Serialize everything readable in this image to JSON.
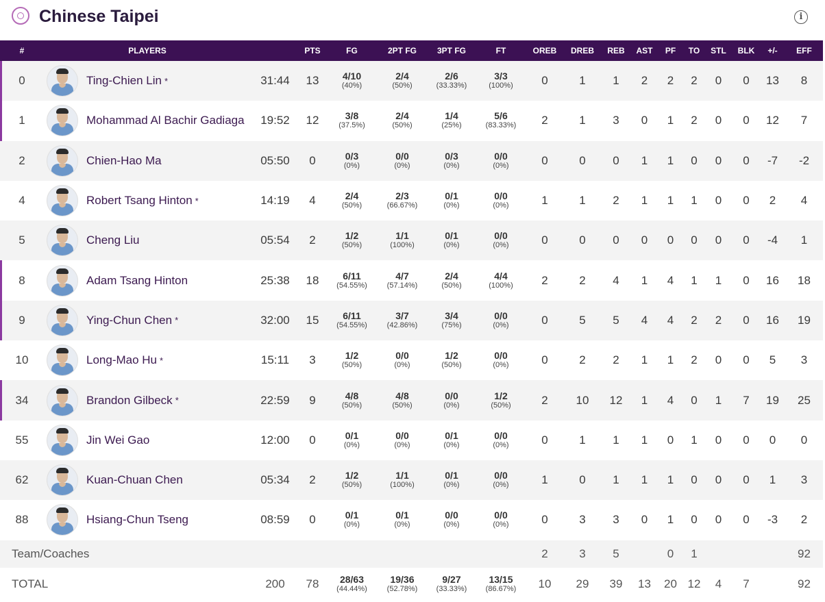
{
  "header": {
    "team_name": "Chinese Taipei",
    "logo_icon": "team-flag-logo-icon",
    "info_icon": "info-icon"
  },
  "columns": [
    "#",
    "PLAYERS",
    "",
    "PTS",
    "FG",
    "2PT FG",
    "3PT FG",
    "FT",
    "OREB",
    "DREB",
    "REB",
    "AST",
    "PF",
    "TO",
    "STL",
    "BLK",
    "+/-",
    "EFF"
  ],
  "players": [
    {
      "num": "0",
      "name": "Ting-Chien Lin",
      "star": "*",
      "min": "31:44",
      "pts": "13",
      "fg": "4/10",
      "fgp": "(40%)",
      "fg2": "2/4",
      "fg2p": "(50%)",
      "fg3": "2/6",
      "fg3p": "(33.33%)",
      "ft": "3/3",
      "ftp": "(100%)",
      "oreb": "0",
      "dreb": "1",
      "reb": "1",
      "ast": "2",
      "pf": "2",
      "to": "2",
      "stl": "0",
      "blk": "0",
      "pm": "13",
      "eff": "8",
      "starter": true
    },
    {
      "num": "1",
      "name": "Mohammad Al Bachir Gadiaga",
      "star": "",
      "min": "19:52",
      "pts": "12",
      "fg": "3/8",
      "fgp": "(37.5%)",
      "fg2": "2/4",
      "fg2p": "(50%)",
      "fg3": "1/4",
      "fg3p": "(25%)",
      "ft": "5/6",
      "ftp": "(83.33%)",
      "oreb": "2",
      "dreb": "1",
      "reb": "3",
      "ast": "0",
      "pf": "1",
      "to": "2",
      "stl": "0",
      "blk": "0",
      "pm": "12",
      "eff": "7",
      "starter": true
    },
    {
      "num": "2",
      "name": "Chien-Hao Ma",
      "star": "",
      "min": "05:50",
      "pts": "0",
      "fg": "0/3",
      "fgp": "(0%)",
      "fg2": "0/0",
      "fg2p": "(0%)",
      "fg3": "0/3",
      "fg3p": "(0%)",
      "ft": "0/0",
      "ftp": "(0%)",
      "oreb": "0",
      "dreb": "0",
      "reb": "0",
      "ast": "1",
      "pf": "1",
      "to": "0",
      "stl": "0",
      "blk": "0",
      "pm": "-7",
      "eff": "-2",
      "starter": false
    },
    {
      "num": "4",
      "name": "Robert Tsang Hinton",
      "star": "*",
      "min": "14:19",
      "pts": "4",
      "fg": "2/4",
      "fgp": "(50%)",
      "fg2": "2/3",
      "fg2p": "(66.67%)",
      "fg3": "0/1",
      "fg3p": "(0%)",
      "ft": "0/0",
      "ftp": "(0%)",
      "oreb": "1",
      "dreb": "1",
      "reb": "2",
      "ast": "1",
      "pf": "1",
      "to": "1",
      "stl": "0",
      "blk": "0",
      "pm": "2",
      "eff": "4",
      "starter": false
    },
    {
      "num": "5",
      "name": "Cheng Liu",
      "star": "",
      "min": "05:54",
      "pts": "2",
      "fg": "1/2",
      "fgp": "(50%)",
      "fg2": "1/1",
      "fg2p": "(100%)",
      "fg3": "0/1",
      "fg3p": "(0%)",
      "ft": "0/0",
      "ftp": "(0%)",
      "oreb": "0",
      "dreb": "0",
      "reb": "0",
      "ast": "0",
      "pf": "0",
      "to": "0",
      "stl": "0",
      "blk": "0",
      "pm": "-4",
      "eff": "1",
      "starter": false
    },
    {
      "num": "8",
      "name": "Adam Tsang Hinton",
      "star": "",
      "min": "25:38",
      "pts": "18",
      "fg": "6/11",
      "fgp": "(54.55%)",
      "fg2": "4/7",
      "fg2p": "(57.14%)",
      "fg3": "2/4",
      "fg3p": "(50%)",
      "ft": "4/4",
      "ftp": "(100%)",
      "oreb": "2",
      "dreb": "2",
      "reb": "4",
      "ast": "1",
      "pf": "4",
      "to": "1",
      "stl": "1",
      "blk": "0",
      "pm": "16",
      "eff": "18",
      "starter": true
    },
    {
      "num": "9",
      "name": "Ying-Chun Chen",
      "star": "*",
      "min": "32:00",
      "pts": "15",
      "fg": "6/11",
      "fgp": "(54.55%)",
      "fg2": "3/7",
      "fg2p": "(42.86%)",
      "fg3": "3/4",
      "fg3p": "(75%)",
      "ft": "0/0",
      "ftp": "(0%)",
      "oreb": "0",
      "dreb": "5",
      "reb": "5",
      "ast": "4",
      "pf": "4",
      "to": "2",
      "stl": "2",
      "blk": "0",
      "pm": "16",
      "eff": "19",
      "starter": true
    },
    {
      "num": "10",
      "name": "Long-Mao Hu",
      "star": "*",
      "min": "15:11",
      "pts": "3",
      "fg": "1/2",
      "fgp": "(50%)",
      "fg2": "0/0",
      "fg2p": "(0%)",
      "fg3": "1/2",
      "fg3p": "(50%)",
      "ft": "0/0",
      "ftp": "(0%)",
      "oreb": "0",
      "dreb": "2",
      "reb": "2",
      "ast": "1",
      "pf": "1",
      "to": "2",
      "stl": "0",
      "blk": "0",
      "pm": "5",
      "eff": "3",
      "starter": false
    },
    {
      "num": "34",
      "name": "Brandon Gilbeck",
      "star": "*",
      "min": "22:59",
      "pts": "9",
      "fg": "4/8",
      "fgp": "(50%)",
      "fg2": "4/8",
      "fg2p": "(50%)",
      "fg3": "0/0",
      "fg3p": "(0%)",
      "ft": "1/2",
      "ftp": "(50%)",
      "oreb": "2",
      "dreb": "10",
      "reb": "12",
      "ast": "1",
      "pf": "4",
      "to": "0",
      "stl": "1",
      "blk": "7",
      "pm": "19",
      "eff": "25",
      "starter": true
    },
    {
      "num": "55",
      "name": "Jin Wei Gao",
      "star": "",
      "min": "12:00",
      "pts": "0",
      "fg": "0/1",
      "fgp": "(0%)",
      "fg2": "0/0",
      "fg2p": "(0%)",
      "fg3": "0/1",
      "fg3p": "(0%)",
      "ft": "0/0",
      "ftp": "(0%)",
      "oreb": "0",
      "dreb": "1",
      "reb": "1",
      "ast": "1",
      "pf": "0",
      "to": "1",
      "stl": "0",
      "blk": "0",
      "pm": "0",
      "eff": "0",
      "starter": false
    },
    {
      "num": "62",
      "name": "Kuan-Chuan Chen",
      "star": "",
      "min": "05:34",
      "pts": "2",
      "fg": "1/2",
      "fgp": "(50%)",
      "fg2": "1/1",
      "fg2p": "(100%)",
      "fg3": "0/1",
      "fg3p": "(0%)",
      "ft": "0/0",
      "ftp": "(0%)",
      "oreb": "1",
      "dreb": "0",
      "reb": "1",
      "ast": "1",
      "pf": "1",
      "to": "0",
      "stl": "0",
      "blk": "0",
      "pm": "1",
      "eff": "3",
      "starter": false
    },
    {
      "num": "88",
      "name": "Hsiang-Chun Tseng",
      "star": "",
      "min": "08:59",
      "pts": "0",
      "fg": "0/1",
      "fgp": "(0%)",
      "fg2": "0/1",
      "fg2p": "(0%)",
      "fg3": "0/0",
      "fg3p": "(0%)",
      "ft": "0/0",
      "ftp": "(0%)",
      "oreb": "0",
      "dreb": "3",
      "reb": "3",
      "ast": "0",
      "pf": "1",
      "to": "0",
      "stl": "0",
      "blk": "0",
      "pm": "-3",
      "eff": "2",
      "starter": false
    }
  ],
  "team_row": {
    "label": "Team/Coaches",
    "oreb": "2",
    "dreb": "3",
    "reb": "5",
    "ast": "",
    "pf": "0",
    "to": "1",
    "stl": "",
    "blk": "",
    "pm": "",
    "eff": "92"
  },
  "total_row": {
    "label": "TOTAL",
    "min": "200",
    "pts": "78",
    "fg": "28/63",
    "fgp": "(44.44%)",
    "fg2": "19/36",
    "fg2p": "(52.78%)",
    "fg3": "9/27",
    "fg3p": "(33.33%)",
    "ft": "13/15",
    "ftp": "(86.67%)",
    "oreb": "10",
    "dreb": "29",
    "reb": "39",
    "ast": "13",
    "pf": "20",
    "to": "12",
    "stl": "4",
    "blk": "7",
    "pm": "",
    "eff": "92"
  },
  "colors": {
    "header_bg": "#3c1154",
    "starter_marker": "#8b3aa0",
    "name_color": "#3c1a50"
  }
}
